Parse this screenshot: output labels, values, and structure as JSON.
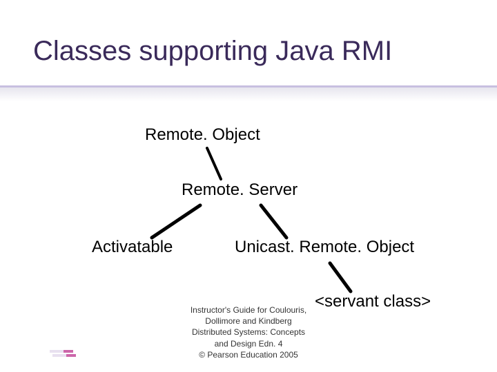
{
  "title": "Classes supporting Java RMI",
  "nodes": {
    "root": "Remote. Object",
    "server": "Remote. Server",
    "activatable": "Activatable",
    "unicast": "Unicast. Remote. Object",
    "servant": "<servant class>"
  },
  "footer": {
    "l1": "Instructor's Guide for  Coulouris,",
    "l2": "Dollimore and Kindberg",
    "l3": "Distributed Systems: Concepts",
    "l4": "and Design   Edn. 4",
    "l5": "©   Pearson Education 2005"
  },
  "colors": {
    "title": "#3a2a5a",
    "logo_accent": "#cc66aa"
  }
}
